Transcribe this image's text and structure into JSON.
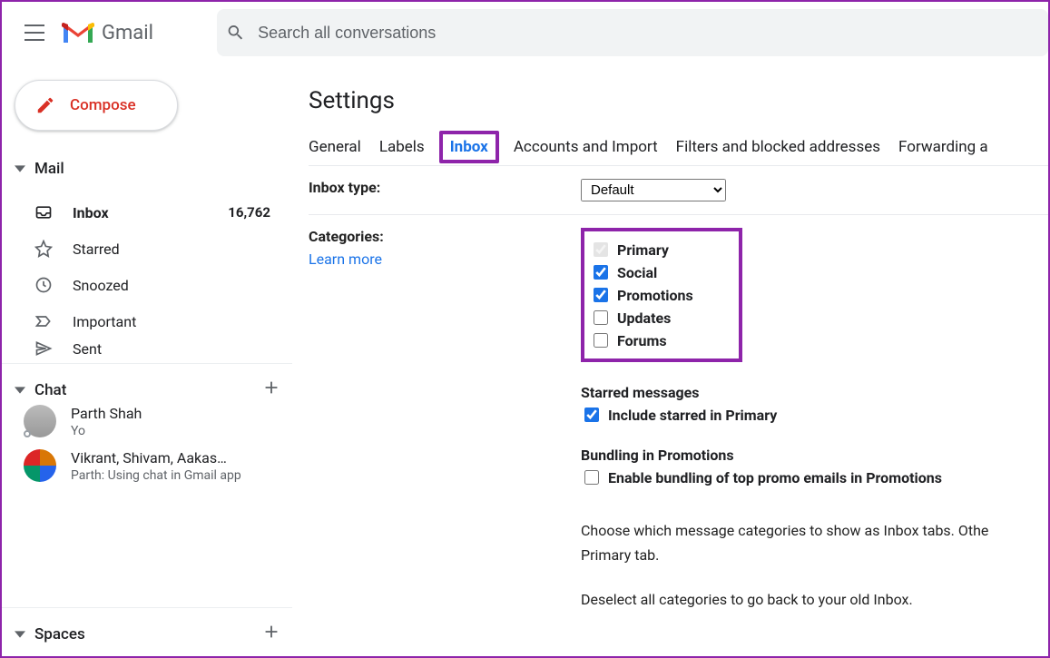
{
  "header": {
    "app_name": "Gmail",
    "search_placeholder": "Search all conversations"
  },
  "sidebar": {
    "compose_label": "Compose",
    "mail_section": "Mail",
    "chat_section": "Chat",
    "spaces_section": "Spaces",
    "nav": [
      {
        "label": "Inbox",
        "count": "16,762",
        "bold": true
      },
      {
        "label": "Starred"
      },
      {
        "label": "Snoozed"
      },
      {
        "label": "Important"
      },
      {
        "label": "Sent"
      }
    ],
    "chats": [
      {
        "name": "Parth Shah",
        "snippet": "Yo"
      },
      {
        "name": "Vikrant, Shivam, Aakas…",
        "snippet": "Parth: Using chat in Gmail app"
      }
    ]
  },
  "settings": {
    "title": "Settings",
    "tabs": [
      "General",
      "Labels",
      "Inbox",
      "Accounts and Import",
      "Filters and blocked addresses",
      "Forwarding a"
    ],
    "active_tab": "Inbox",
    "inbox_type": {
      "label": "Inbox type:",
      "selected": "Default",
      "options": [
        "Default"
      ]
    },
    "categories": {
      "label": "Categories:",
      "learn_more": "Learn more",
      "items": [
        {
          "label": "Primary",
          "checked": true,
          "disabled": true
        },
        {
          "label": "Social",
          "checked": true,
          "disabled": false
        },
        {
          "label": "Promotions",
          "checked": true,
          "disabled": false
        },
        {
          "label": "Updates",
          "checked": false,
          "disabled": false
        },
        {
          "label": "Forums",
          "checked": false,
          "disabled": false
        }
      ],
      "starred_heading": "Starred messages",
      "starred_option": {
        "label": "Include starred in Primary",
        "checked": true
      },
      "bundling_heading": "Bundling in Promotions",
      "bundling_option": {
        "label": "Enable bundling of top promo emails in Promotions",
        "checked": false
      },
      "desc1": "Choose which message categories to show as Inbox tabs. Othe",
      "desc2": "Primary tab.",
      "desc3": "Deselect all categories to go back to your old Inbox."
    }
  }
}
